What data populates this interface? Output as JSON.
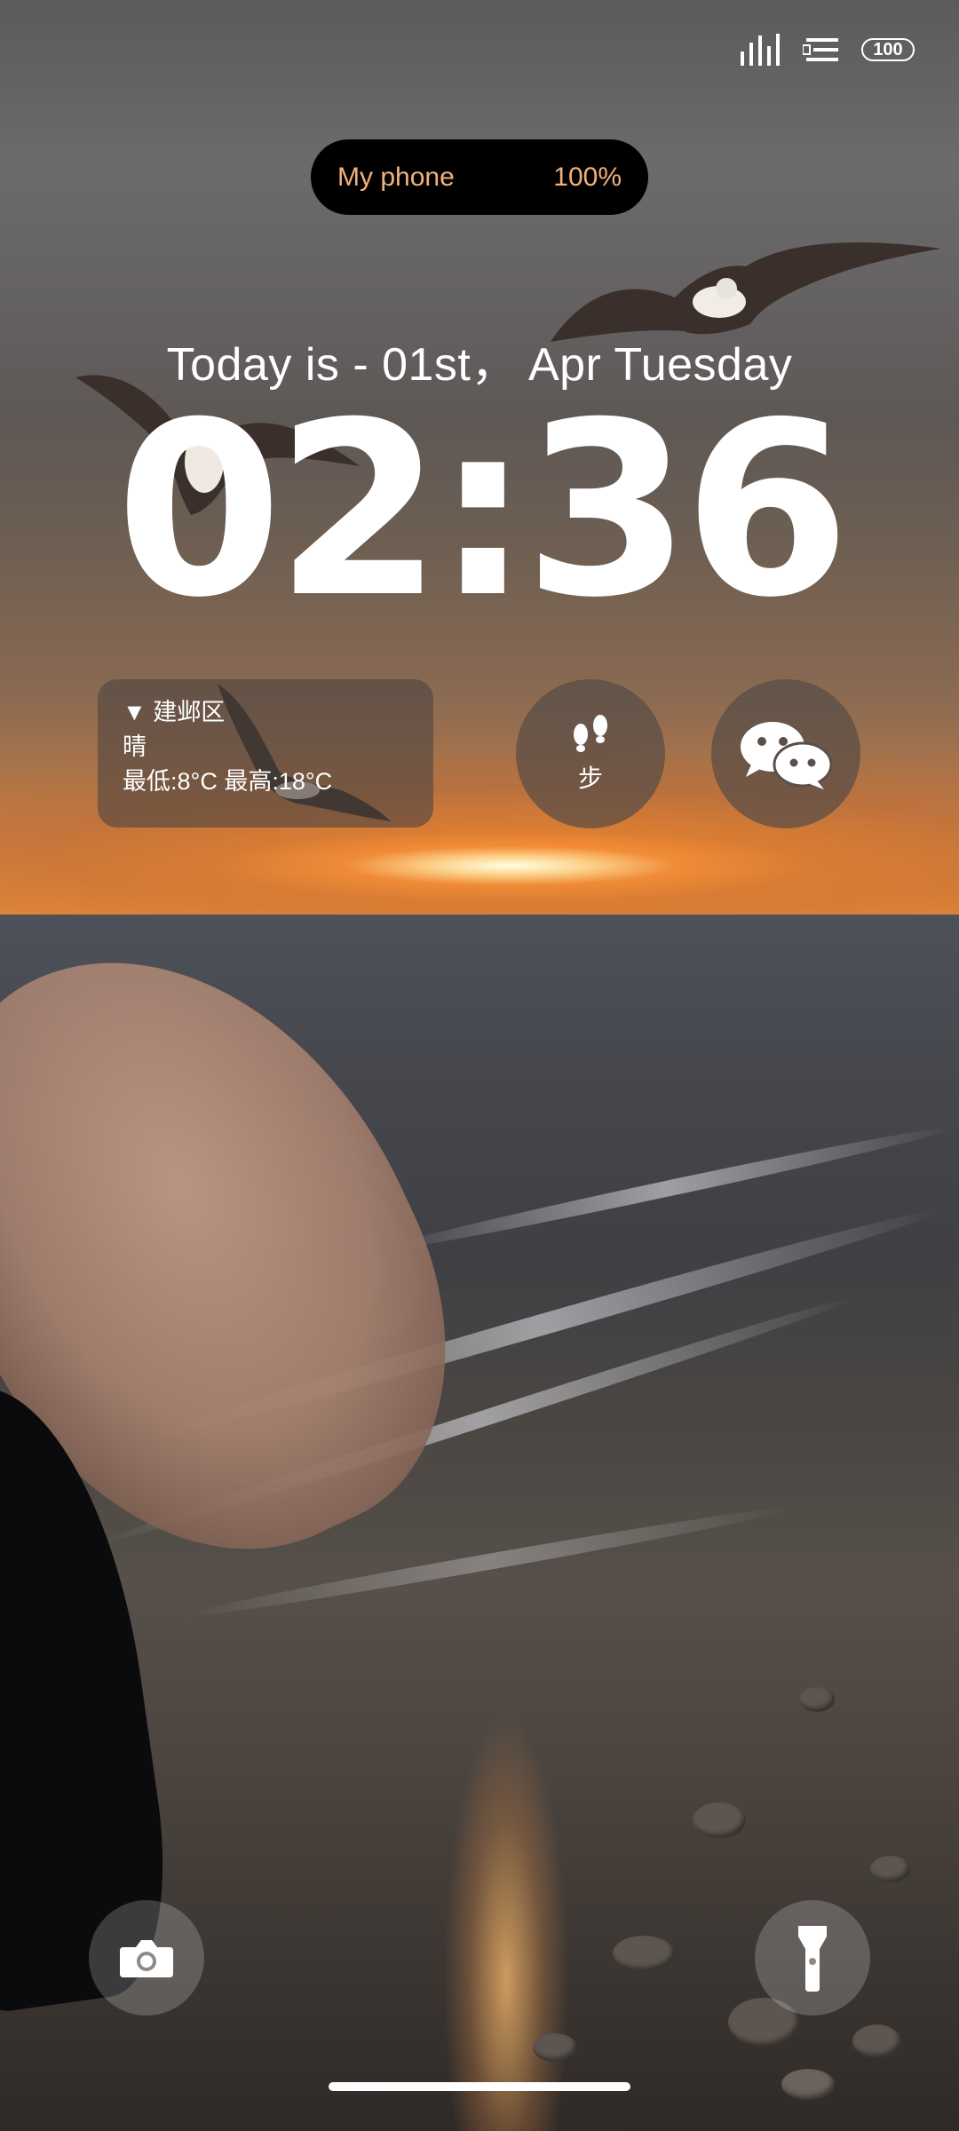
{
  "status_bar": {
    "signal_icon": "signal-bars-icon",
    "data_icon": "data-transfer-icon",
    "battery_level": "100"
  },
  "phone_pill": {
    "device_name": "My phone",
    "battery_percent": "100%"
  },
  "lockscreen": {
    "date_text": "Today is - 01st， Apr   Tuesday",
    "time": "02:36"
  },
  "weather_widget": {
    "location": "▼ 建邺区",
    "condition": "晴",
    "temperature_range": "最低:8°C  最高:18°C"
  },
  "steps_widget": {
    "icon": "footprints-icon",
    "label": "步"
  },
  "wechat_widget": {
    "icon": "wechat-icon"
  },
  "shortcuts": {
    "camera_icon": "camera-icon",
    "flashlight_icon": "flashlight-icon"
  },
  "colors": {
    "pill_text": "#f2b17a",
    "widget_bg": "#504641"
  }
}
